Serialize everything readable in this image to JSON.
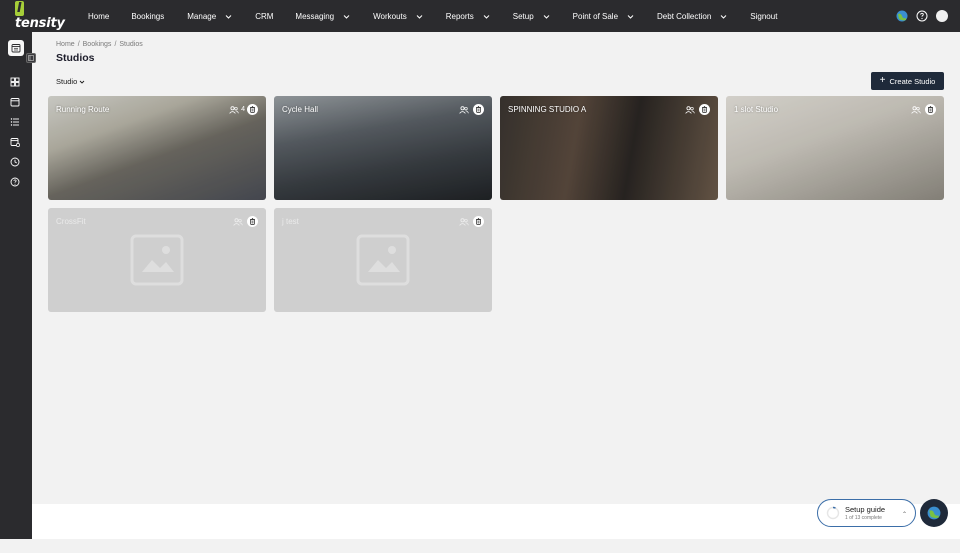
{
  "brand": {
    "logo_first": "I",
    "logo_rest": "tensity"
  },
  "nav": {
    "items": [
      {
        "label": "Home",
        "dropdown": false,
        "gap": 22
      },
      {
        "label": "Bookings",
        "dropdown": false,
        "gap": 23
      },
      {
        "label": "Manage",
        "dropdown": true,
        "gap": 23
      },
      {
        "label": "CRM",
        "dropdown": false,
        "gap": 22
      },
      {
        "label": "Messaging",
        "dropdown": true,
        "gap": 23
      },
      {
        "label": "Workouts",
        "dropdown": true,
        "gap": 23
      },
      {
        "label": "Reports",
        "dropdown": true,
        "gap": 23
      },
      {
        "label": "Setup",
        "dropdown": true,
        "gap": 23
      },
      {
        "label": "Point of Sale",
        "dropdown": true,
        "gap": 23
      },
      {
        "label": "Debt Collection",
        "dropdown": true,
        "gap": 23
      },
      {
        "label": "Signout",
        "dropdown": false,
        "gap": 0
      }
    ]
  },
  "breadcrumb": {
    "home": "Home",
    "sep1": "/",
    "bookings": "Bookings",
    "sep2": "/",
    "current": "Studios"
  },
  "page": {
    "title": "Studios",
    "filter_label": "Studio",
    "create_label": "Create Studio"
  },
  "studios": [
    {
      "name": "Running Route",
      "count": "4",
      "image": "photo-1"
    },
    {
      "name": "Cycle Hall",
      "count": "",
      "image": "photo-2"
    },
    {
      "name": "SPINNING STUDIO A",
      "count": "",
      "image": "photo-3"
    },
    {
      "name": "1 slot Studio",
      "count": "",
      "image": "photo-4"
    },
    {
      "name": "CrossFit",
      "count": "",
      "image": "placeholder"
    },
    {
      "name": "j test",
      "count": "",
      "image": "placeholder"
    }
  ],
  "setup_guide": {
    "title": "Setup guide",
    "progress": "1 of 13 complete"
  },
  "colors": {
    "nav_bg": "#2b2b2e",
    "accent": "#1f2a3a",
    "brand_green": "#a6ce39"
  }
}
